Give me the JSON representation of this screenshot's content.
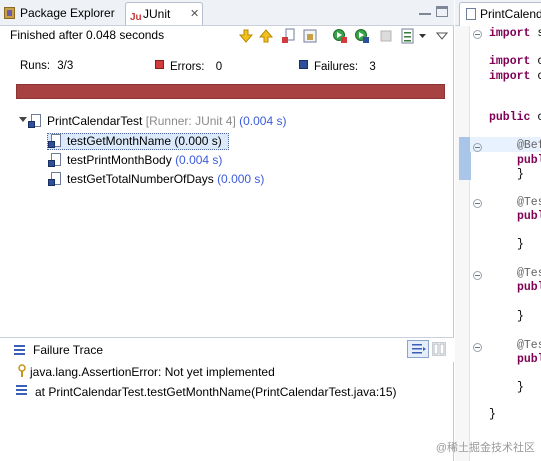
{
  "tabs": {
    "package_explorer": "Package Explorer",
    "junit": "JUnit",
    "editor": "PrintCalend"
  },
  "status_text": "Finished after 0.048 seconds",
  "stats": {
    "runs_label": "Runs:",
    "runs_value": "3/3",
    "errors_label": "Errors:",
    "errors_value": "0",
    "failures_label": "Failures:",
    "failures_value": "3"
  },
  "progress": {
    "fraction": 1.0,
    "color": "#a74142"
  },
  "tree": {
    "root": {
      "name": "PrintCalendarTest",
      "runner": "[Runner: JUnit 4]",
      "time": "(0.004 s)"
    },
    "children": [
      {
        "name": "testGetMonthName",
        "time": "(0.000 s)"
      },
      {
        "name": "testPrintMonthBody",
        "time": "(0.004 s)"
      },
      {
        "name": "testGetTotalNumberOfDays",
        "time": "(0.000 s)"
      }
    ]
  },
  "failure_trace": {
    "title": "Failure Trace",
    "lines": [
      "java.lang.AssertionError: Not yet implemented",
      "at PrintCalendarTest.testGetMonthName(PrintCalendarTest.java:15)"
    ]
  },
  "editor": {
    "import1_kw": "import",
    "import1_rest": " s",
    "import2_kw": "import",
    "import2_rest": " c",
    "import3_kw": "import",
    "import3_rest": " c",
    "class_kw": "public",
    "class_rest": " c",
    "ann1": "@Bef",
    "m1_kw": "publi",
    "brace1": "}",
    "ann2": "@Tes",
    "m2_kw": "publi",
    "brace2": "}",
    "ann3": "@Tes",
    "m3_kw": "publi",
    "brace3": "}",
    "ann4": "@Tes",
    "m4_kw": "publi",
    "brace4": "}",
    "brace_end": "}"
  },
  "watermark": "@稀土掘金技术社区",
  "colors": {
    "failure_bar": "#a74142",
    "time_text": "#3b5bd8",
    "keyword": "#7f0055"
  }
}
